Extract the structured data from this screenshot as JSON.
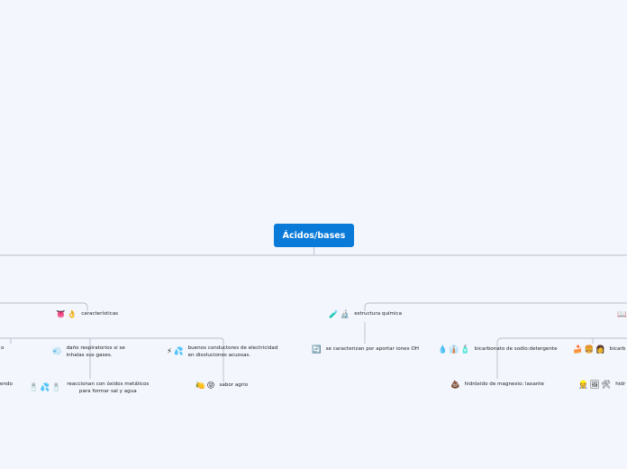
{
  "root": {
    "title": "Ácidos/bases"
  },
  "nodes": {
    "caracteristicas": {
      "label": "características",
      "icons": [
        "👅",
        "👌"
      ]
    },
    "estructura": {
      "label": "estructura química",
      "icons": [
        "🧪",
        "🔬"
      ]
    },
    "right_stub_icon": "📖",
    "dano": {
      "label": "daño respiratorios si se inhalas sus gases.",
      "icons": [
        "💨"
      ]
    },
    "conductores": {
      "label": "buenos conductores de electricidad en disoluciones acuosas.",
      "icons": [
        "⚡",
        "💦"
      ]
    },
    "reaccionan": {
      "label": "reaccionan con óxidos metálicos para formar sal y agua",
      "icons": [
        "🧂",
        "💦",
        "🧂"
      ]
    },
    "sabor": {
      "label": "sabor agrio",
      "icons": [
        "🍋",
        "😝"
      ]
    },
    "oh": {
      "label": "se caracterizan por aportar iones OH",
      "icons": [
        "🔄"
      ]
    },
    "bicarbonato": {
      "label": "bicarbonato de sodio:detergente",
      "icons": [
        "💧",
        "👔",
        "🧴"
      ]
    },
    "magnesio": {
      "label": "hidróxido de magnesio: laxante",
      "icons": [
        "💩"
      ]
    },
    "right_bicarb": {
      "label": "bicarb",
      "icons": [
        "🍰",
        "🍔",
        "👩"
      ]
    },
    "right_hid": {
      "label": "hidr",
      "icons": [
        "👷",
        "🖼",
        "🛠"
      ]
    },
    "left_cut_a": {
      "label": "o"
    },
    "left_cut_b": {
      "label": "endo"
    }
  },
  "colors": {
    "background": "#f3f6fd",
    "root": "#0a7ad9",
    "line": "#b8bfca"
  }
}
